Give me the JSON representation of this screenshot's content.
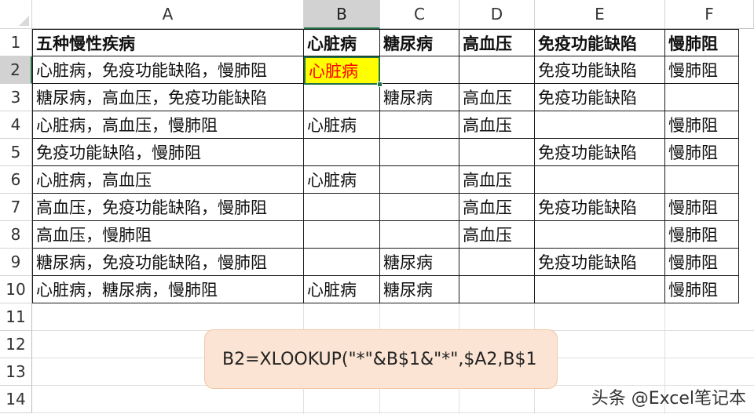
{
  "columns": [
    "A",
    "B",
    "C",
    "D",
    "E",
    "F"
  ],
  "rows": [
    "1",
    "2",
    "3",
    "4",
    "5",
    "6",
    "7",
    "8",
    "9",
    "10",
    "11",
    "12",
    "13",
    "14"
  ],
  "selected_column": "B",
  "selected_row": "2",
  "table": {
    "header": [
      "五种慢性疾病",
      "心脏病",
      "糖尿病",
      "高血压",
      "免疫功能缺陷",
      "慢肺阻"
    ],
    "body": [
      [
        "心脏病，免疫功能缺陷，慢肺阻",
        "心脏病",
        "",
        "",
        "免疫功能缺陷",
        "慢肺阻"
      ],
      [
        "糖尿病，高血压，免疫功能缺陷",
        "",
        "糖尿病",
        "高血压",
        "免疫功能缺陷",
        ""
      ],
      [
        "心脏病，高血压，慢肺阻",
        "心脏病",
        "",
        "高血压",
        "",
        "慢肺阻"
      ],
      [
        "免疫功能缺陷，慢肺阻",
        "",
        "",
        "",
        "免疫功能缺陷",
        "慢肺阻"
      ],
      [
        "心脏病，高血压",
        "心脏病",
        "",
        "高血压",
        "",
        ""
      ],
      [
        "高血压，免疫功能缺陷，慢肺阻",
        "",
        "",
        "高血压",
        "免疫功能缺陷",
        "慢肺阻"
      ],
      [
        "高血压，慢肺阻",
        "",
        "",
        "高血压",
        "",
        "慢肺阻"
      ],
      [
        "糖尿病，免疫功能缺陷，慢肺阻",
        "",
        "糖尿病",
        "",
        "免疫功能缺陷",
        "慢肺阻"
      ],
      [
        "心脏病，糖尿病，慢肺阻",
        "心脏病",
        "糖尿病",
        "",
        "",
        "慢肺阻"
      ]
    ]
  },
  "formula_note": "B2=XLOOKUP(\"*\"&B$1&\"*\",$A2,B$1",
  "watermark": "头条 @Excel笔记本",
  "colors": {
    "active_fill": "#ffff00",
    "active_text": "#ff0000",
    "selection_accent": "#217346",
    "note_fill": "#fbe4d3"
  }
}
